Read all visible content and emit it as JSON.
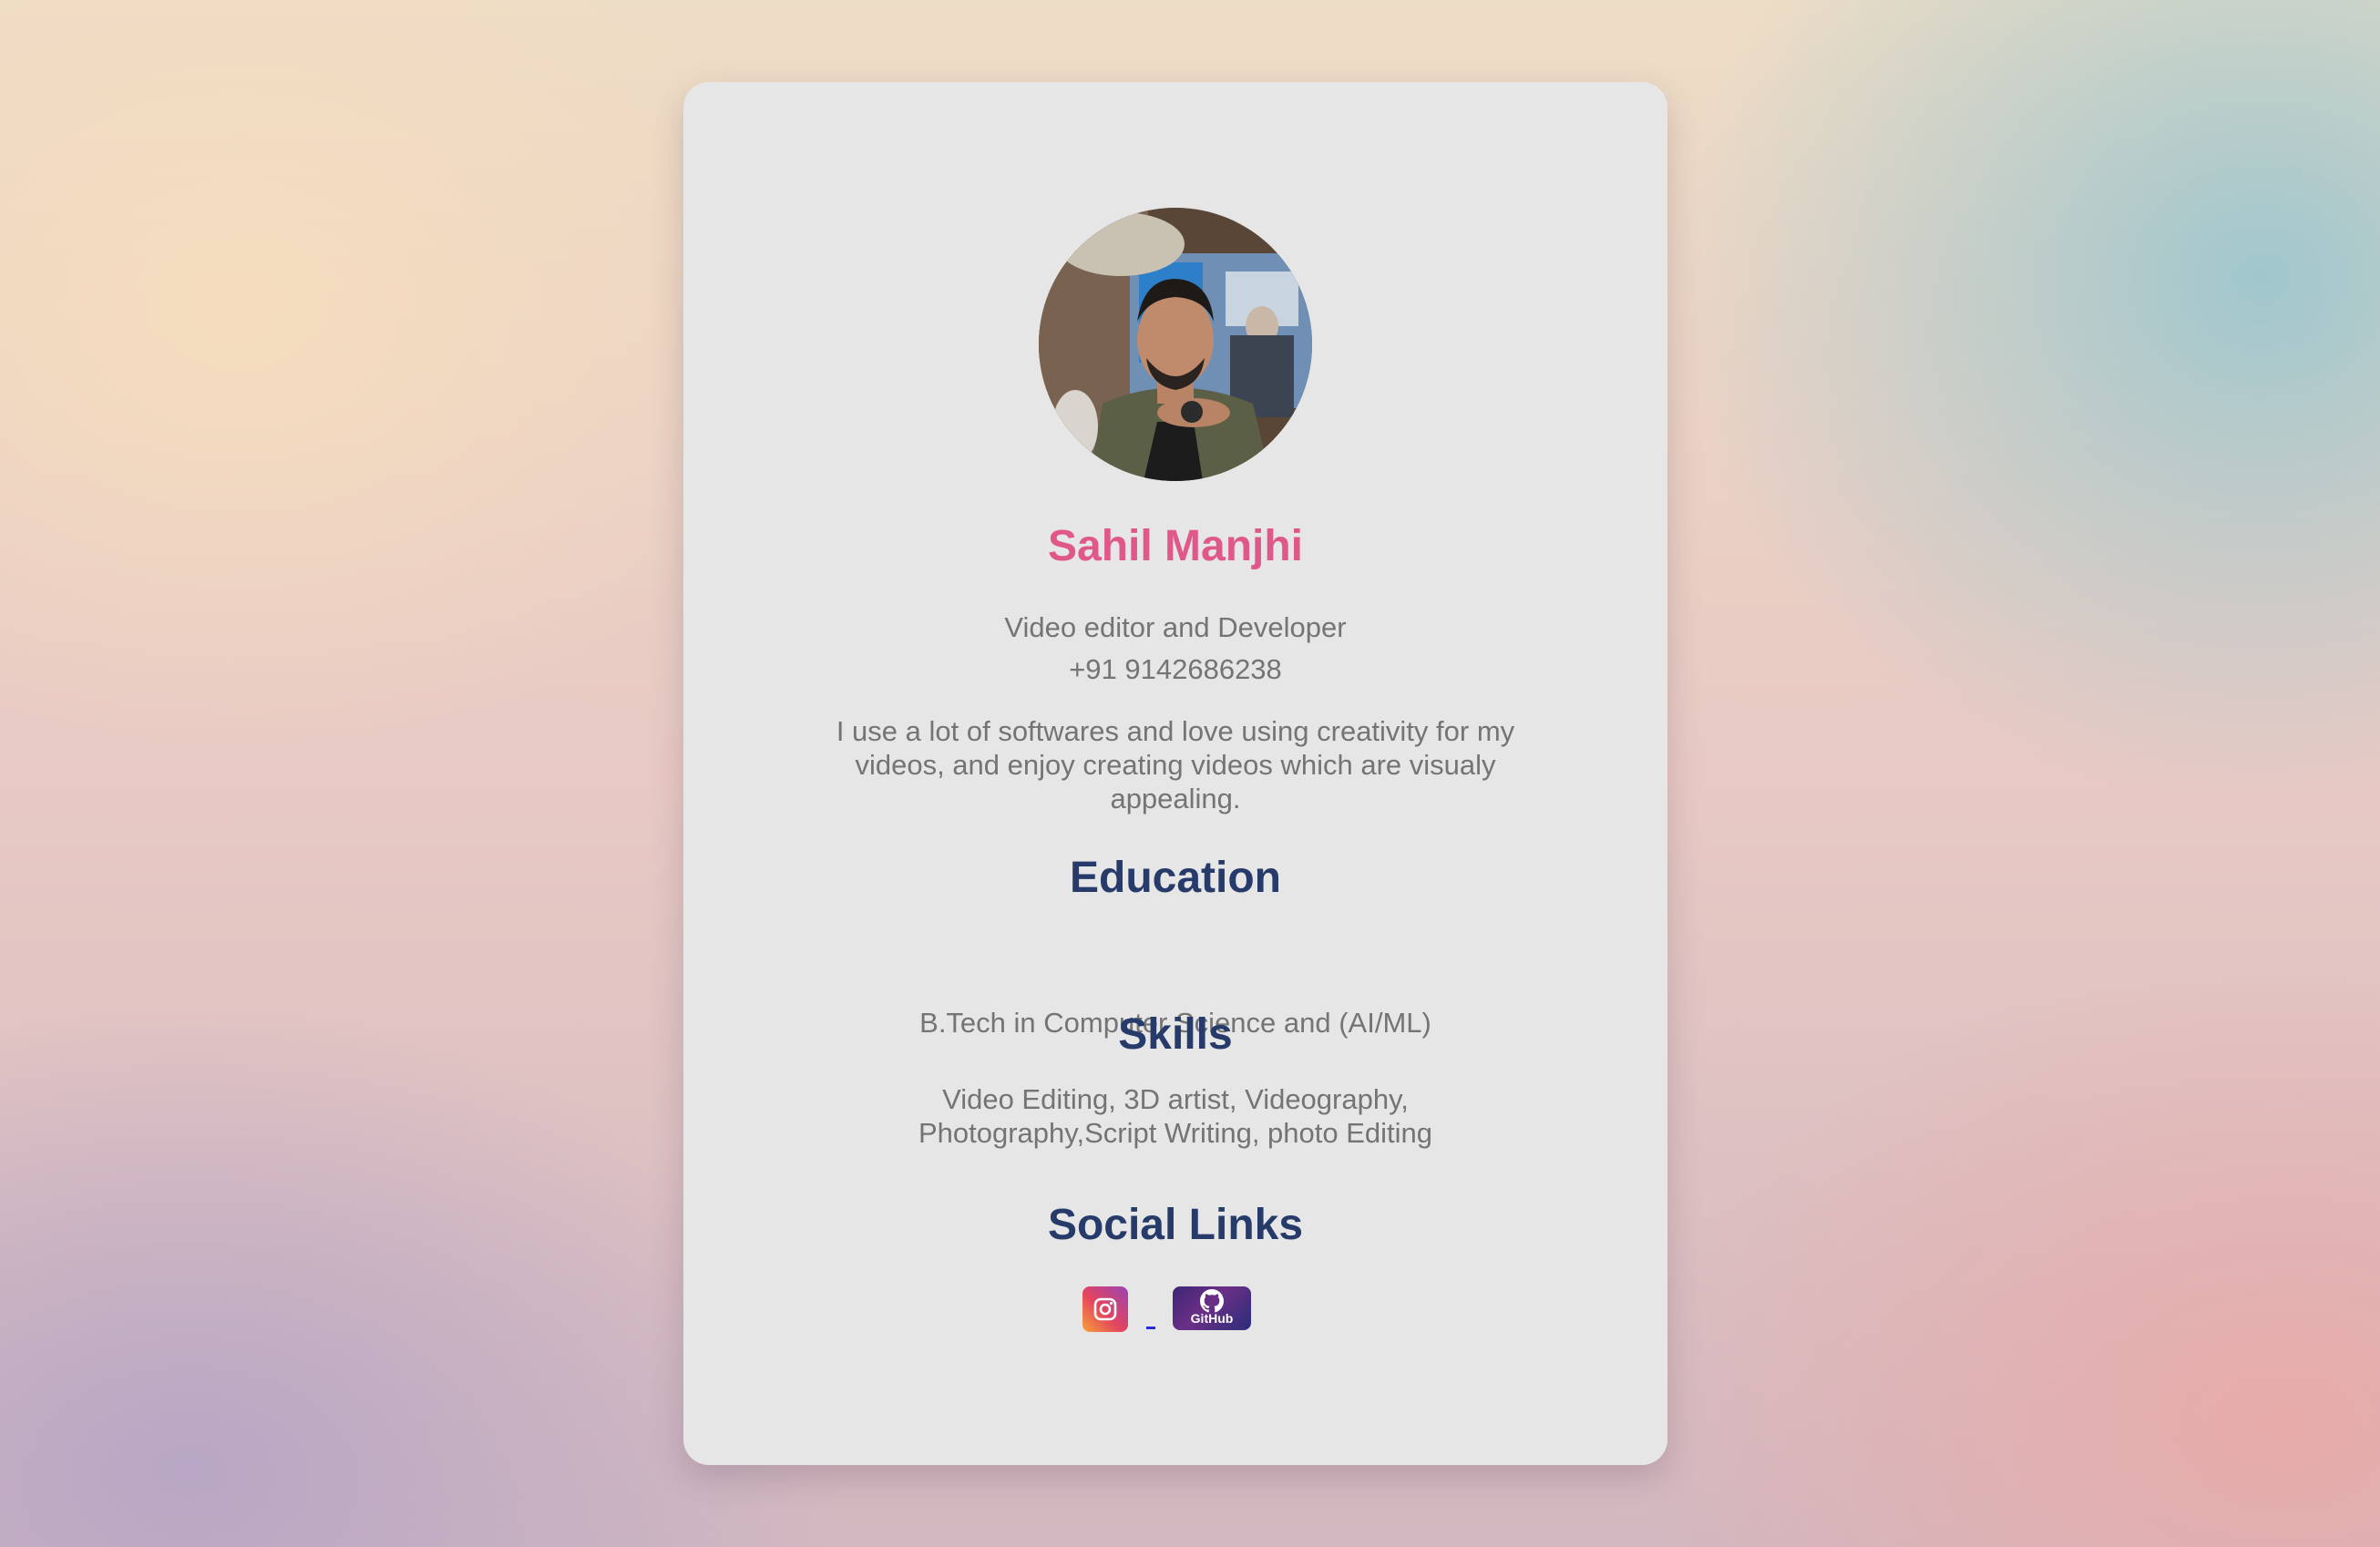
{
  "profile": {
    "name": "Sahil Manjhi",
    "role": "Video editor and Developer",
    "phone": "+91 9142686238",
    "bio": "I use a lot of softwares and love using creativity for my videos, and enjoy creating videos which are visualy appealing."
  },
  "education": {
    "heading": "Education",
    "text": "B.Tech in Computer Science and (AI/ML)"
  },
  "skills": {
    "heading": "Skills",
    "text": "Video Editing, 3D artist, Videography, Photography,Script Writing, photo Editing"
  },
  "social": {
    "heading": "Social Links",
    "links": [
      {
        "icon": "instagram-icon"
      },
      {
        "icon": "github-icon",
        "label": "GitHub"
      }
    ]
  },
  "colors": {
    "name": "#e0588a",
    "heading": "#263b6a",
    "body_text": "#747474",
    "card": "#e7e6e7"
  }
}
